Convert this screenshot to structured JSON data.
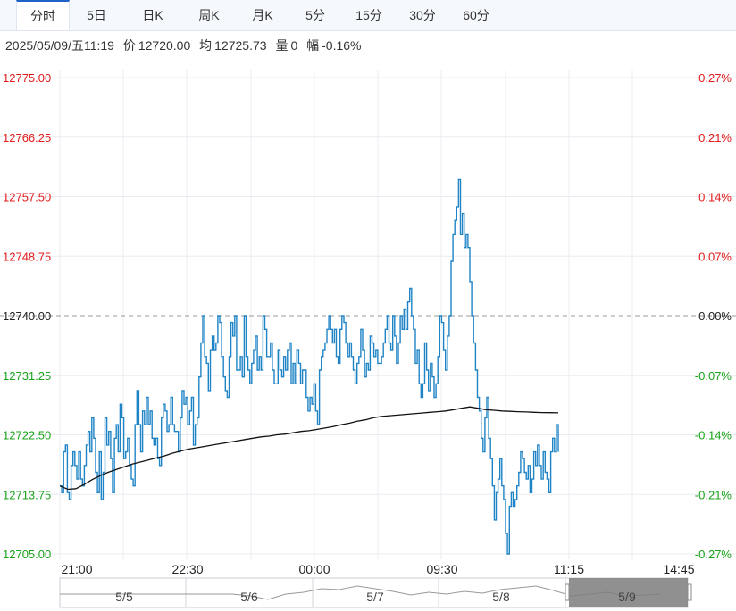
{
  "tabs": [
    {
      "label": "分时",
      "active": true
    },
    {
      "label": "5日",
      "active": false
    },
    {
      "label": "日K",
      "active": false
    },
    {
      "label": "周K",
      "active": false
    },
    {
      "label": "月K",
      "active": false
    },
    {
      "label": "5分",
      "active": false
    },
    {
      "label": "15分",
      "active": false
    },
    {
      "label": "30分",
      "active": false
    },
    {
      "label": "60分",
      "active": false
    }
  ],
  "info": {
    "datetime": "2025/05/09/五11:19",
    "price_label": "价",
    "price": "12720.00",
    "avg_label": "均",
    "avg": "12725.73",
    "vol_label": "量",
    "vol": "0",
    "change_label": "幅",
    "change": "-0.16%"
  },
  "colors": {
    "up": "#e01b1b",
    "down": "#1aa31a",
    "neutral": "#222222",
    "price_line": "#1f84c6",
    "avg_line": "#111111",
    "grid": "#e8ecf1",
    "navigator_mask": "#7d7d7d"
  },
  "chart_data": {
    "type": "line",
    "base_price": 12740.0,
    "y_ticks": [
      "12775.00",
      "12766.25",
      "12757.50",
      "12748.75",
      "12740.00",
      "12731.25",
      "12722.50",
      "12713.75",
      "12705.00"
    ],
    "y_tick_values": [
      12775.0,
      12766.25,
      12757.5,
      12748.75,
      12740.0,
      12731.25,
      12722.5,
      12713.75,
      12705.0
    ],
    "pct_ticks": [
      "0.27%",
      "0.21%",
      "0.14%",
      "0.07%",
      "0.00%",
      "-0.07%",
      "-0.14%",
      "-0.21%",
      "-0.27%"
    ],
    "ylim": [
      12705.0,
      12775.0
    ],
    "x_ticks": [
      "21:00",
      "22:30",
      "00:00",
      "09:30",
      "11:15",
      "14:45"
    ],
    "series": [
      {
        "name": "价",
        "values": [
          12715,
          12714,
          12720,
          12721,
          12714,
          12713,
          12718,
          12720,
          12718,
          12716,
          12720,
          12716,
          12715,
          12718,
          12721,
          12723,
          12720,
          12725,
          12722,
          12717,
          12714,
          12720,
          12713,
          12717,
          12725,
          12721,
          12723,
          12719,
          12714,
          12722,
          12724,
          12720,
          12727,
          12725,
          12719,
          12720,
          12722,
          12718,
          12716,
          12715,
          12724,
          12729,
          12724,
          12720,
          12726,
          12724,
          12728,
          12724,
          12726,
          12722,
          12721,
          12722,
          12719,
          12718,
          12725,
          12727,
          12726,
          12723,
          12724,
          12728,
          12724,
          12723,
          12723,
          12720,
          12725,
          12729,
          12727,
          12728,
          12724,
          12726,
          12728,
          12721,
          12724,
          12725,
          12731,
          12736,
          12740,
          12734,
          12733,
          12729,
          12735,
          12737,
          12735,
          12736,
          12740,
          12739,
          12734,
          12731,
          12729,
          12728,
          12734,
          12739,
          12737,
          12740,
          12732,
          12732,
          12734,
          12731,
          12740,
          12734,
          12732,
          12730,
          12733,
          12735,
          12737,
          12732,
          12734,
          12732,
          12740,
          12738,
          12734,
          12734,
          12736,
          12732,
          12730,
          12730,
          12735,
          12732,
          12731,
          12734,
          12732,
          12735,
          12736,
          12730,
          12733,
          12730,
          12735,
          12733,
          12730,
          12732,
          12732,
          12728,
          12726,
          12728,
          12727,
          12730,
          12726,
          12724,
          12732,
          12734,
          12735,
          12736,
          12738,
          12740,
          12738,
          12736,
          12738,
          12734,
          12733,
          12738,
          12740,
          12739,
          12736,
          12734,
          12736,
          12734,
          12732,
          12730,
          12733,
          12734,
          12738,
          12735,
          12731,
          12733,
          12732,
          12737,
          12736,
          12734,
          12735,
          12733,
          12733,
          12734,
          12736,
          12738,
          12740,
          12736,
          12735,
          12740,
          12737,
          12733,
          12736,
          12740,
          12738,
          12741,
          12738,
          12742,
          12744,
          12740,
          12738,
          12733,
          12735,
          12730,
          12728,
          12730,
          12736,
          12732,
          12729,
          12733,
          12731,
          12728,
          12730,
          12734,
          12740,
          12739,
          12735,
          12732,
          12737,
          12740,
          12748,
          12752,
          12754,
          12756,
          12760,
          12752,
          12755,
          12750,
          12752,
          12750,
          12745,
          12740,
          12736,
          12732,
          12728,
          12726,
          12722,
          12720,
          12725,
          12728,
          12722,
          12719,
          12715,
          12710,
          12714,
          12716,
          12719,
          12715,
          12713,
          12708,
          12705,
          12712,
          12714,
          12712,
          12713,
          12715,
          12717,
          12720,
          12719,
          12717,
          12716,
          12718,
          12714,
          12716,
          12720,
          12718,
          12721,
          12718,
          12716,
          12720,
          12717,
          12716,
          12714,
          12720,
          12722,
          12720,
          12724,
          12720
        ]
      },
      {
        "name": "均",
        "values": [
          12715.0,
          12714.5,
          12714.6,
          12715.2,
          12715.9,
          12716.5,
          12717.0,
          12717.4,
          12717.8,
          12718.2,
          12718.5,
          12718.8,
          12719.1,
          12719.4,
          12719.8,
          12720.1,
          12720.4,
          12720.6,
          12720.8,
          12721.0,
          12721.2,
          12721.4,
          12721.6,
          12721.8,
          12722.0,
          12722.2,
          12722.3,
          12722.5,
          12722.6,
          12722.8,
          12723.0,
          12723.1,
          12723.3,
          12723.5,
          12723.7,
          12724.0,
          12724.2,
          12724.5,
          12724.7,
          12725.0,
          12725.2,
          12725.3,
          12725.4,
          12725.5,
          12725.6,
          12725.7,
          12725.8,
          12725.9,
          12726.0,
          12726.2,
          12726.4,
          12726.6,
          12726.4,
          12726.2,
          12726.1,
          12726.0,
          12725.95,
          12725.9,
          12725.85,
          12725.8,
          12725.77,
          12725.75,
          12725.73
        ]
      }
    ],
    "navigator": {
      "labels": [
        "5/5",
        "5/6",
        "5/7",
        "5/8",
        "5/9"
      ],
      "selected": "5/9"
    }
  }
}
